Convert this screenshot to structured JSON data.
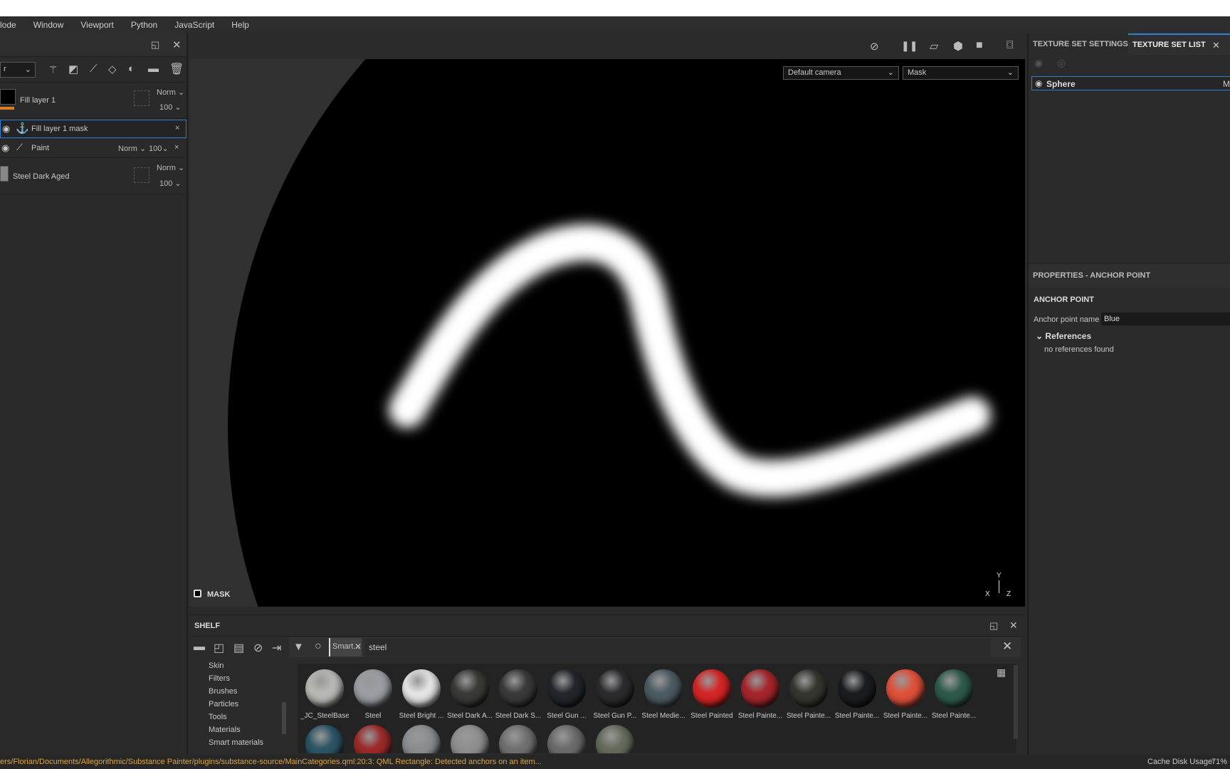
{
  "menu": [
    "lode",
    "Window",
    "Viewport",
    "Python",
    "JavaScript",
    "Help"
  ],
  "layers": {
    "blend_dropdown": "r",
    "items": [
      {
        "name": "Fill layer 1",
        "blend": "Norm",
        "opacity": "100"
      },
      {
        "name": "Fill layer 1 mask",
        "selected": true
      },
      {
        "name": "Paint",
        "blend": "Norm",
        "opacity": "100"
      },
      {
        "name": "Steel Dark Aged",
        "blend": "Norm",
        "opacity": "100"
      }
    ]
  },
  "viewport": {
    "camera": "Default camera",
    "channel": "Mask",
    "mode_label": "MASK",
    "axes": {
      "y": "Y",
      "x": "X",
      "z": "Z"
    }
  },
  "shelf": {
    "title": "SHELF",
    "filter_chip": "Smart...",
    "search": "steel",
    "categories": [
      "Skin",
      "Filters",
      "Brushes",
      "Particles",
      "Tools",
      "Materials",
      "Smart materials"
    ],
    "materials": [
      {
        "name": "_JC_SteelBase",
        "color": "#b9b9b4"
      },
      {
        "name": "Steel",
        "color": "#9a9ea2"
      },
      {
        "name": "Steel Bright ...",
        "color": "#e4e4e4"
      },
      {
        "name": "Steel Dark A...",
        "color": "#3b3b36"
      },
      {
        "name": "Steel Dark S...",
        "color": "#3a3a3a"
      },
      {
        "name": "Steel Gun ...",
        "color": "#23272b"
      },
      {
        "name": "Steel Gun P...",
        "color": "#2c2c2e"
      },
      {
        "name": "Steel Medie...",
        "color": "#4d5b62"
      },
      {
        "name": "Steel Painted",
        "color": "#d52525"
      },
      {
        "name": "Steel Painte...",
        "color": "#a5262c"
      },
      {
        "name": "Steel Painte...",
        "color": "#36362f"
      },
      {
        "name": "Steel Painte...",
        "color": "#1c1d20"
      },
      {
        "name": "Steel Painte...",
        "color": "#e0513a"
      },
      {
        "name": "Steel Painte...",
        "color": "#2e5a4c"
      }
    ],
    "row2_colors": [
      "#2c5566",
      "#9c2a2a",
      "#8a8d90",
      "#8e8e8e",
      "#707070",
      "#6b6b6b",
      "#646b5b"
    ]
  },
  "right": {
    "tabs": [
      "TEXTURE SET SETTINGS",
      "TEXTURE SET LIST"
    ],
    "texture_set": "Sphere",
    "texture_set_extra": "M",
    "properties_title": "PROPERTIES - ANCHOR POINT",
    "section": "ANCHOR POINT",
    "field_label": "Anchor point name",
    "field_value": "Blue",
    "references_label": "References",
    "references_empty": "no references found"
  },
  "status": {
    "message": "ers/Florian/Documents/Allegorithmic/Substance Painter/plugins/substance-source/MainCategories.qml:20:3: QML Rectangle: Detected anchors on an item...",
    "cache_label": "Cache Disk Usage:",
    "cache_value": "71%"
  },
  "colors": {
    "accent": "#2f7ed8",
    "status_warning": "#e0a53a",
    "layer_orange": "#e07b20"
  }
}
